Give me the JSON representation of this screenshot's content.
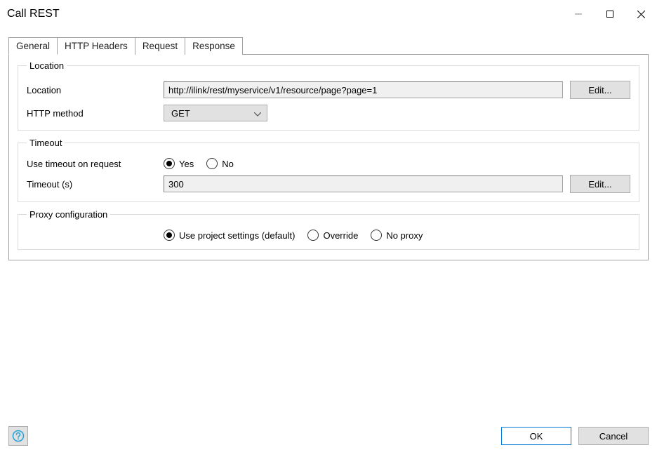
{
  "window": {
    "title": "Call REST"
  },
  "tabs": {
    "general": "General",
    "http_headers": "HTTP Headers",
    "request": "Request",
    "response": "Response"
  },
  "location_group": {
    "legend": "Location",
    "location_label": "Location",
    "location_value": "http://ilink/rest/myservice/v1/resource/page?page=1",
    "edit_label": "Edit...",
    "http_method_label": "HTTP method",
    "http_method_value": "GET"
  },
  "timeout_group": {
    "legend": "Timeout",
    "use_timeout_label": "Use timeout on request",
    "yes_label": "Yes",
    "no_label": "No",
    "timeout_label": "Timeout (s)",
    "timeout_value": "300",
    "edit_label": "Edit..."
  },
  "proxy_group": {
    "legend": "Proxy configuration",
    "use_project_label": "Use project settings (default)",
    "override_label": "Override",
    "no_proxy_label": "No proxy"
  },
  "footer": {
    "ok_label": "OK",
    "cancel_label": "Cancel"
  }
}
